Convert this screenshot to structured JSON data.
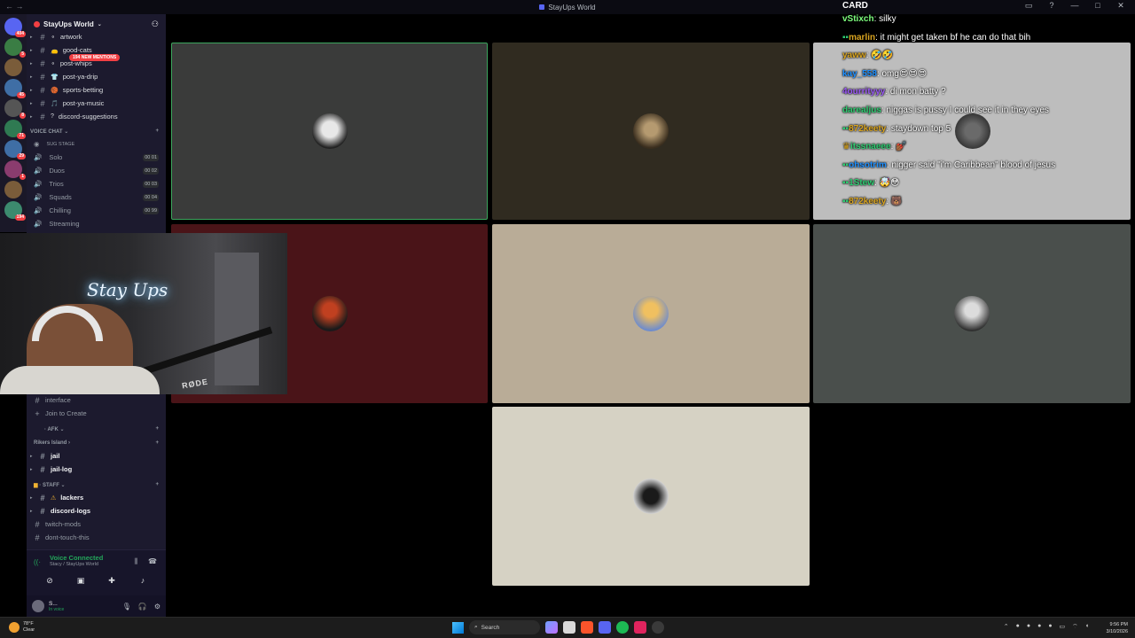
{
  "window": {
    "title": "StayUps World"
  },
  "rail": {
    "top_badge": "404",
    "badges": [
      "5",
      "45",
      "8",
      "71",
      "29",
      "1",
      "194"
    ]
  },
  "sidebar": {
    "server_name": "StayUps World",
    "new_mentions": "194 NEW MENTIONS",
    "channels_top": [
      {
        "label": "artwork",
        "emoji": "⚬"
      },
      {
        "label": "good-cats",
        "emoji": "👝"
      },
      {
        "label": "post-whips",
        "emoji": "⚬"
      },
      {
        "label": "post-ya-drip",
        "emoji": "👕"
      },
      {
        "label": "sports-betting",
        "emoji": "🏀"
      },
      {
        "label": "post-ya-music",
        "emoji": "🎵"
      },
      {
        "label": "discord-suggestions",
        "emoji": "?"
      }
    ],
    "voice_category": "VOICE CHAT",
    "stage": "SUG STAGE",
    "voice_channels": [
      {
        "label": "Solo",
        "count": "00 01"
      },
      {
        "label": "Duos",
        "count": "00 02"
      },
      {
        "label": "Trios",
        "count": "00 03"
      },
      {
        "label": "Squads",
        "count": "00 04"
      },
      {
        "label": "Chilling",
        "count": "00 99"
      },
      {
        "label": "Streaming",
        "count": ""
      }
    ],
    "lower_channels": [
      {
        "label": "interface",
        "muted": true
      },
      {
        "label": "Join to Create",
        "muted": true
      }
    ],
    "afk_category": "AFK",
    "rikers_category": "Rikers Island",
    "rikers_channels": [
      "jail",
      "jail-log"
    ],
    "staff_category": "Staff",
    "staff_channels": [
      {
        "label": "lackers",
        "muted": false
      },
      {
        "label": "discord-logs",
        "muted": false
      },
      {
        "label": "twitch-mods",
        "muted": true
      },
      {
        "label": "dont-touch-this",
        "muted": true
      }
    ],
    "voice_status": "Voice Connected",
    "voice_location": "Stacy / StayUps World",
    "user_name": "S...",
    "user_status": "In voice"
  },
  "chat": {
    "top_line": "CARD",
    "lines": [
      {
        "user": "vStixch",
        "color": "#7CFC7C",
        "text": "silky"
      },
      {
        "user": "marlin",
        "color": "#DAA520",
        "text": "it might get taken bf he can do that bih"
      },
      {
        "user": "yaww",
        "color": "#DAA520",
        "text": "🤣🤣"
      },
      {
        "user": "kay_558",
        "color": "#1E90FF",
        "text": "omg😍😍😍"
      },
      {
        "user": "4ourrityyy",
        "color": "#9B59F6",
        "text": "di mon batty ?"
      },
      {
        "user": "darealjus",
        "color": "#2ECC71",
        "text": "niggas is pussy I could see it in they eyes"
      },
      {
        "user": "872keety",
        "color": "#DAA520",
        "text": "staydown top 5"
      },
      {
        "user": "itssnaeee",
        "color": "#2ECC71",
        "text": "💅🏾"
      },
      {
        "user": "ohsotrim",
        "color": "#1E90FF",
        "text": "nigger said \"i'm Caribbean\" blood of jesus"
      },
      {
        "user": "1Stew",
        "color": "#2ECC71",
        "text": "🤯😳"
      },
      {
        "user": "872keety",
        "color": "#DAA520",
        "text": "🐻"
      }
    ]
  },
  "webcam": {
    "neon_text": "Stay Ups",
    "mic_brand": "RØDE"
  },
  "taskbar": {
    "temp": "78°F",
    "weather": "Clear",
    "search": "Search",
    "time": "9:56 PM",
    "date": "3/10/2026"
  }
}
